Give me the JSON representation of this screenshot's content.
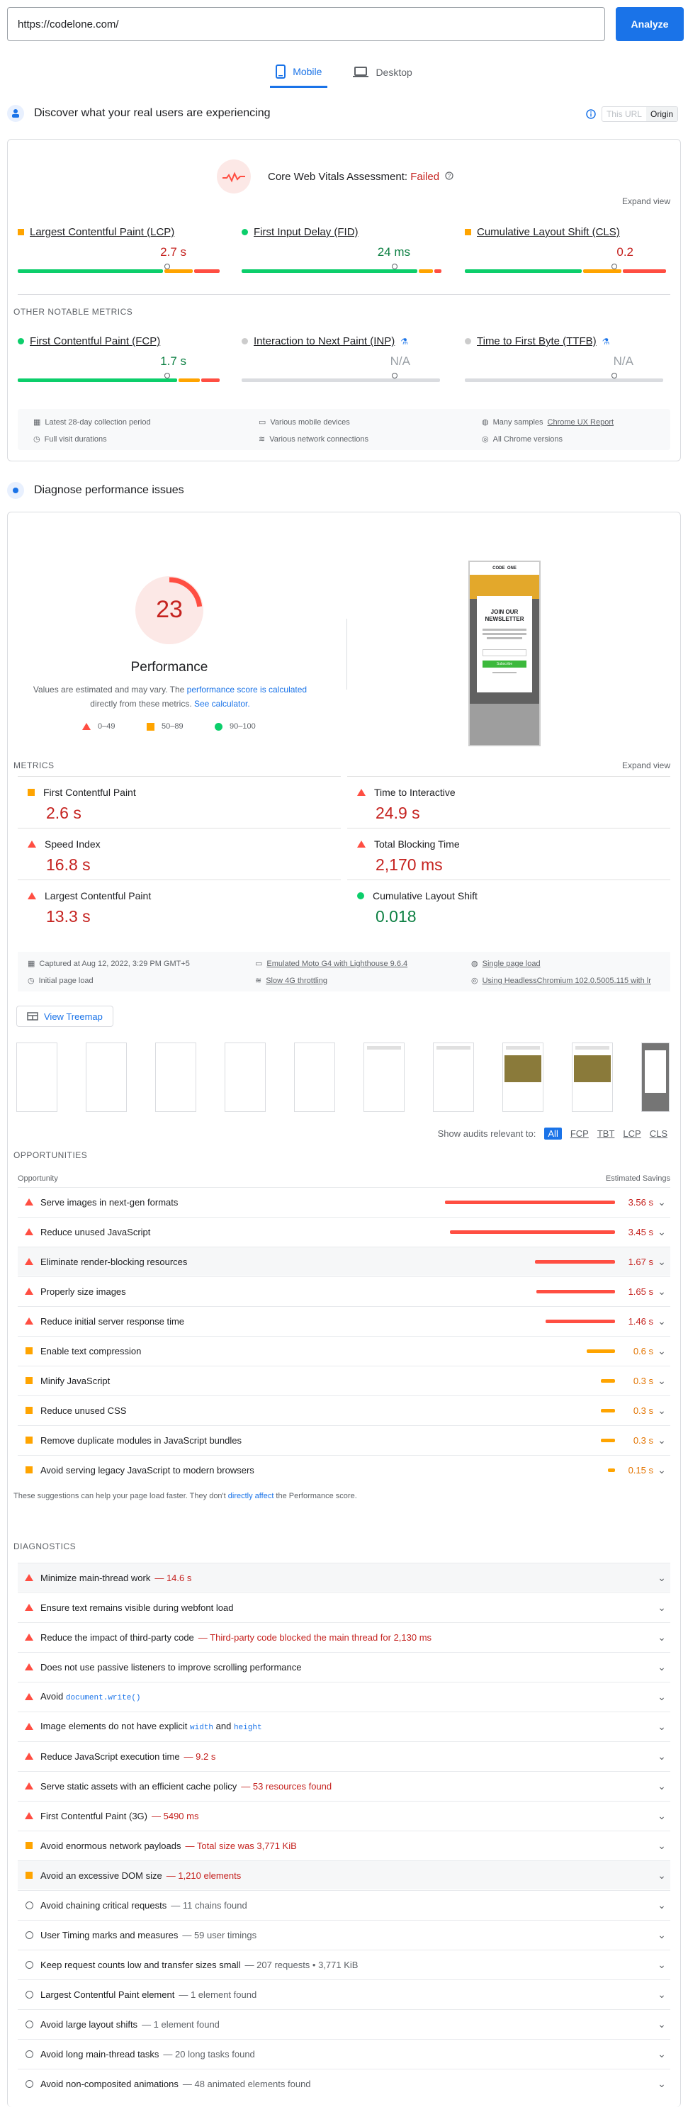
{
  "header": {
    "url": "https://codelone.com/",
    "analyze_label": "Analyze"
  },
  "tabs": [
    {
      "label": "Mobile"
    },
    {
      "label": "Desktop"
    }
  ],
  "field": {
    "heading": "Discover what your real users are experiencing",
    "toggle": [
      "This URL",
      "Origin"
    ],
    "assessment_label": "Core Web Vitals Assessment:",
    "assessment_result": "Failed",
    "expand": "Expand view",
    "core": [
      {
        "label": "Largest Contentful Paint (LCP)",
        "value": "2.7 s",
        "status": "average",
        "pin": 0.73
      },
      {
        "label": "First Input Delay (FID)",
        "value": "24 ms",
        "status": "good",
        "pin": 0.75
      },
      {
        "label": "Cumulative Layout Shift (CLS)",
        "value": "0.2",
        "status": "average",
        "pin": 0.74
      }
    ],
    "other_heading": "OTHER NOTABLE METRICS",
    "other": [
      {
        "label": "First Contentful Paint (FCP)",
        "value": "1.7 s",
        "status": "good",
        "pin": 0.73
      },
      {
        "label": "Interaction to Next Paint (INP)",
        "value": "N/A",
        "status": "na",
        "pin": 0.75
      },
      {
        "label": "Time to First Byte (TTFB)",
        "value": "N/A",
        "status": "na",
        "pin": 0.74
      }
    ],
    "info": [
      "Latest 28-day collection period",
      "Various mobile devices",
      "Many samples ",
      "Chrome UX Report",
      "Full visit durations",
      "Various network connections",
      "All Chrome versions"
    ]
  },
  "lab": {
    "heading": "Diagnose performance issues",
    "score": "23",
    "score_fraction": 0.23,
    "perf_label": "Performance",
    "note1": "Values are estimated and may vary. The ",
    "note_link1": "performance score is calculated",
    "note2": "directly from these metrics. ",
    "note_link2": "See calculator.",
    "legend": [
      "0–49",
      "50–89",
      "90–100"
    ],
    "phone": {
      "logo": "CODE  ONE",
      "popup_title": "JOIN OUR NEWSLETTER",
      "button": "Subscribe"
    },
    "metrics_label": "METRICS",
    "expand": "Expand view",
    "metrics": [
      {
        "label": "First Contentful Paint",
        "value": "2.6 s",
        "status": "average"
      },
      {
        "label": "Time to Interactive",
        "value": "24.9 s",
        "status": "poor"
      },
      {
        "label": "Speed Index",
        "value": "16.8 s",
        "status": "poor"
      },
      {
        "label": "Total Blocking Time",
        "value": "2,170 ms",
        "status": "poor"
      },
      {
        "label": "Largest Contentful Paint",
        "value": "13.3 s",
        "status": "poor"
      },
      {
        "label": "Cumulative Layout Shift",
        "value": "0.018",
        "status": "good"
      }
    ],
    "info": [
      "Captured at Aug 12, 2022, 3:29 PM GMT+5",
      "Emulated Moto G4 with Lighthouse 9.6.4",
      "Single page load",
      "Initial page load",
      "Slow 4G throttling",
      "Using HeadlessChromium 102.0.5005.115 with lr"
    ],
    "treemap": "View Treemap",
    "filters_label": "Show audits relevant to:",
    "filters": [
      "All",
      "FCP",
      "TBT",
      "LCP",
      "CLS"
    ],
    "opp_heading": "OPPORTUNITIES",
    "opp_col1": "Opportunity",
    "opp_col2": "Estimated Savings",
    "opportunities": [
      {
        "title": "Serve images in next-gen formats",
        "savings": "3.56 s",
        "seconds": 3.56,
        "status": "poor"
      },
      {
        "title": "Reduce unused JavaScript",
        "savings": "3.45 s",
        "seconds": 3.45,
        "status": "poor"
      },
      {
        "title": "Eliminate render-blocking resources",
        "savings": "1.67 s",
        "seconds": 1.67,
        "status": "poor"
      },
      {
        "title": "Properly size images",
        "savings": "1.65 s",
        "seconds": 1.65,
        "status": "poor"
      },
      {
        "title": "Reduce initial server response time",
        "savings": "1.46 s",
        "seconds": 1.46,
        "status": "poor"
      },
      {
        "title": "Enable text compression",
        "savings": "0.6 s",
        "seconds": 0.6,
        "status": "average"
      },
      {
        "title": "Minify JavaScript",
        "savings": "0.3 s",
        "seconds": 0.3,
        "status": "average"
      },
      {
        "title": "Reduce unused CSS",
        "savings": "0.3 s",
        "seconds": 0.3,
        "status": "average"
      },
      {
        "title": "Remove duplicate modules in JavaScript bundles",
        "savings": "0.3 s",
        "seconds": 0.3,
        "status": "average"
      },
      {
        "title": "Avoid serving legacy JavaScript to modern browsers",
        "savings": "0.15 s",
        "seconds": 0.15,
        "status": "average"
      }
    ],
    "opp_note1": "These suggestions can help your page load faster. They don't ",
    "opp_note_link": "directly affect",
    "opp_note2": " the Performance score.",
    "diag_heading": "DIAGNOSTICS",
    "diagnostics": [
      {
        "title": "Minimize main-thread work",
        "sub": "— 14.6 s",
        "status": "poor"
      },
      {
        "title": "Ensure text remains visible during webfont load",
        "sub": "",
        "status": "poor"
      },
      {
        "title": "Reduce the impact of third-party code",
        "sub": "— Third-party code blocked the main thread for 2,130 ms",
        "status": "poor"
      },
      {
        "title": "Does not use passive listeners to improve scrolling performance",
        "sub": "",
        "status": "poor"
      },
      {
        "title": "Avoid ",
        "code": "document.write()",
        "sub": "",
        "status": "poor"
      },
      {
        "title": "Image elements do not have explicit ",
        "code": "width",
        "mid": " and ",
        "code2": "height",
        "sub": "",
        "status": "poor"
      },
      {
        "title": "Reduce JavaScript execution time",
        "sub": "— 9.2 s",
        "status": "poor"
      },
      {
        "title": "Serve static assets with an efficient cache policy",
        "sub": "— 53 resources found",
        "status": "poor"
      },
      {
        "title": "First Contentful Paint (3G)",
        "sub": "— 5490 ms",
        "status": "poor"
      },
      {
        "title": "Avoid enormous network payloads",
        "sub": "— Total size was 3,771 KiB",
        "status": "average"
      },
      {
        "title": "Avoid an excessive DOM size",
        "sub": "— 1,210 elements",
        "status": "average"
      },
      {
        "title": "Avoid chaining critical requests",
        "sub": "— 11 chains found",
        "status": "info"
      },
      {
        "title": "User Timing marks and measures",
        "sub": "— 59 user timings",
        "status": "info"
      },
      {
        "title": "Keep request counts low and transfer sizes small",
        "sub": "— 207 requests • 3,771 KiB",
        "status": "info"
      },
      {
        "title": "Largest Contentful Paint element",
        "sub": "— 1 element found",
        "status": "info"
      },
      {
        "title": "Avoid large layout shifts",
        "sub": "— 1 element found",
        "status": "info"
      },
      {
        "title": "Avoid long main-thread tasks",
        "sub": "— 20 long tasks found",
        "status": "info"
      },
      {
        "title": "Avoid non-composited animations",
        "sub": "— 48 animated elements found",
        "status": "info"
      }
    ]
  },
  "colors": {
    "accent": "#1a73e8",
    "poor": "#ff4e42",
    "average": "#ffa400",
    "good": "#0cce6b",
    "poor_text": "#c5221f",
    "good_text": "#0d8043"
  }
}
